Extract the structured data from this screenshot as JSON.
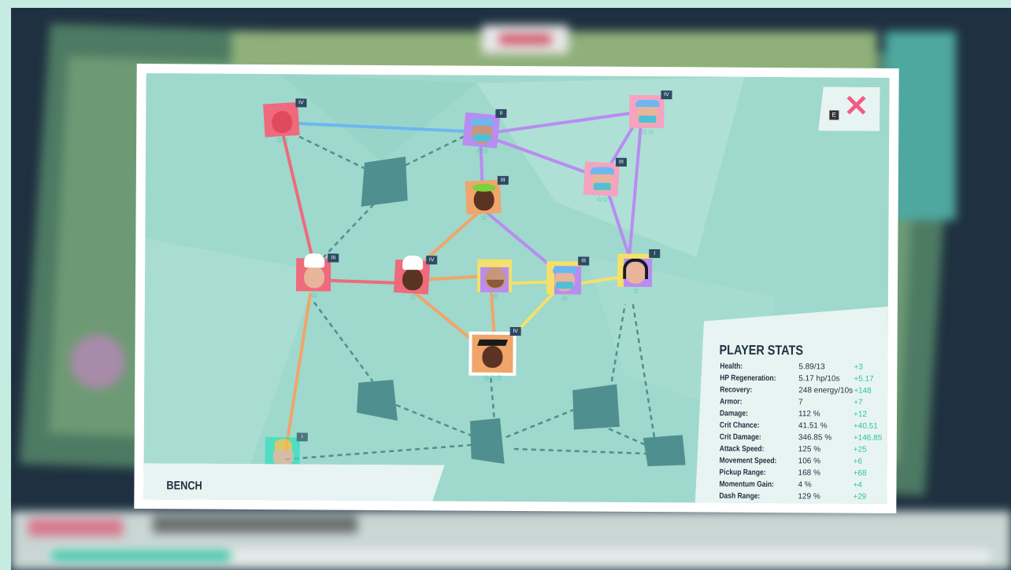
{
  "header": {
    "close_key": "E"
  },
  "bench": {
    "title": "BENCH"
  },
  "stats": {
    "title": "PLAYER STATS",
    "rows": [
      {
        "label": "Health:",
        "value": "5.89/13",
        "bonus": "+3"
      },
      {
        "label": "HP Regeneration:",
        "value": "5.17 hp/10s",
        "bonus": "+5.17"
      },
      {
        "label": "Recovery:",
        "value": "248 energy/10s",
        "bonus": "+148"
      },
      {
        "label": "Armor:",
        "value": "7",
        "bonus": "+7"
      },
      {
        "label": "Damage:",
        "value": "112 %",
        "bonus": "+12"
      },
      {
        "label": "Crit Chance:",
        "value": "41.51 %",
        "bonus": "+40.51"
      },
      {
        "label": "Crit Damage:",
        "value": "346.85 %",
        "bonus": "+146.85"
      },
      {
        "label": "Attack Speed:",
        "value": "125 %",
        "bonus": "+25"
      },
      {
        "label": "Movement Speed:",
        "value": "106 %",
        "bonus": "+6"
      },
      {
        "label": "Pickup Range:",
        "value": "168 %",
        "bonus": "+68"
      },
      {
        "label": "Momentum Gain:",
        "value": "4 %",
        "bonus": "+4"
      },
      {
        "label": "Dash Range:",
        "value": "129 %",
        "bonus": "+29"
      }
    ]
  },
  "colors": {
    "bonus": "#2ec4a2",
    "close": "#f25a86",
    "link_blue": "#6cb7f2",
    "link_purple": "#b98cf2",
    "link_red": "#ee6a7c",
    "link_orange": "#f0a56a",
    "link_yellow": "#f4e06a",
    "slot": "#4f8f8f"
  },
  "nodes": [
    {
      "id": "knight",
      "stars": "☆☆",
      "bg": "#ee6a7c"
    },
    {
      "id": "nurse-top",
      "stars": "☆☆",
      "bg": "#b98cf2"
    },
    {
      "id": "nurse-topright",
      "stars": "☆☆",
      "bg": "#f5a3c0"
    },
    {
      "id": "nurse-mid",
      "stars": "☆☆",
      "bg": "#f5a3c0"
    },
    {
      "id": "gardener",
      "stars": "☆",
      "bg": "#f0a56a"
    },
    {
      "id": "chef-left",
      "stars": "☆",
      "bg": "#ee6a7c"
    },
    {
      "id": "chef-mid",
      "stars": "☆",
      "bg": "#ee6a7c"
    },
    {
      "id": "bearded",
      "stars": "☆",
      "bg": "#b98cf2"
    },
    {
      "id": "nurse-center",
      "stars": "☆",
      "bg": "#b98cf2"
    },
    {
      "id": "woman",
      "stars": "☆",
      "bg": "#f4e06a"
    },
    {
      "id": "graduate",
      "stars": "☆☆☆",
      "bg": "#f0a56a"
    },
    {
      "id": "bench-unit",
      "stars": "☆☆",
      "bg": "#2ee0c0"
    }
  ]
}
